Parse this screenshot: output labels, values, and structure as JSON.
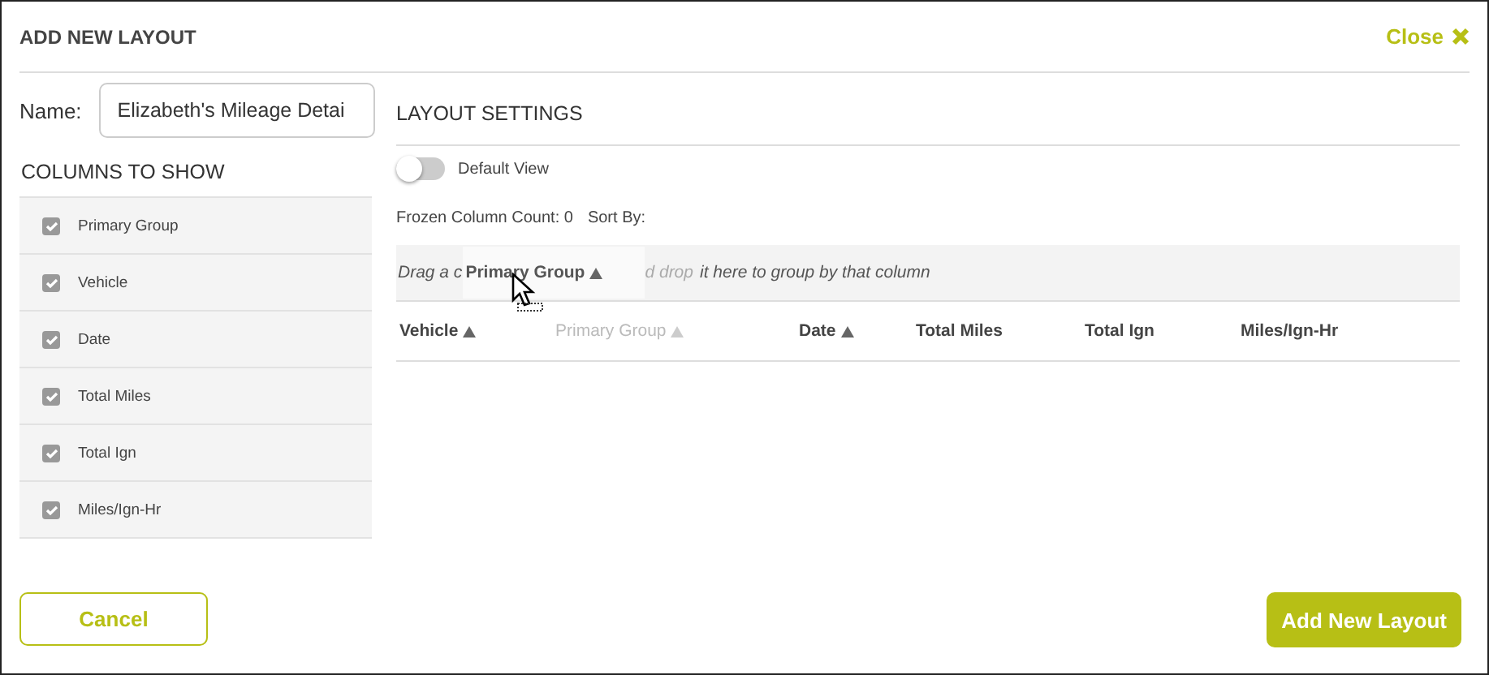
{
  "dialog": {
    "title": "ADD NEW LAYOUT",
    "close": "Close"
  },
  "name_field": {
    "label": "Name:",
    "value": "Elizabeth's Mileage Detai"
  },
  "columns_to_show": {
    "heading": "COLUMNS TO SHOW",
    "items": [
      {
        "label": "Primary Group",
        "checked": true
      },
      {
        "label": "Vehicle",
        "checked": true
      },
      {
        "label": "Date",
        "checked": true
      },
      {
        "label": "Total Miles",
        "checked": true
      },
      {
        "label": "Total Ign",
        "checked": true
      },
      {
        "label": "Miles/Ign-Hr",
        "checked": true
      }
    ]
  },
  "layout_settings": {
    "heading": "LAYOUT SETTINGS",
    "default_view": {
      "label": "Default View",
      "on": false
    },
    "frozen_count": "Frozen Column Count: 0",
    "sort_by": "Sort By:",
    "group_hint": {
      "before": "Drag a c",
      "faded": "d drop",
      "after": "it here to group by that column"
    },
    "drag_chip": {
      "label": "Primary Group",
      "sorted": true
    },
    "columns": [
      {
        "label": "Vehicle",
        "sorted": true,
        "dragging": false
      },
      {
        "label": "Primary Group",
        "sorted": true,
        "dragging": true
      },
      {
        "label": "Date",
        "sorted": true,
        "dragging": false
      },
      {
        "label": "Total Miles",
        "sorted": false,
        "dragging": false
      },
      {
        "label": "Total Ign",
        "sorted": false,
        "dragging": false
      },
      {
        "label": "Miles/Ign-Hr",
        "sorted": false,
        "dragging": false
      }
    ]
  },
  "buttons": {
    "cancel": "Cancel",
    "submit": "Add New Layout"
  }
}
